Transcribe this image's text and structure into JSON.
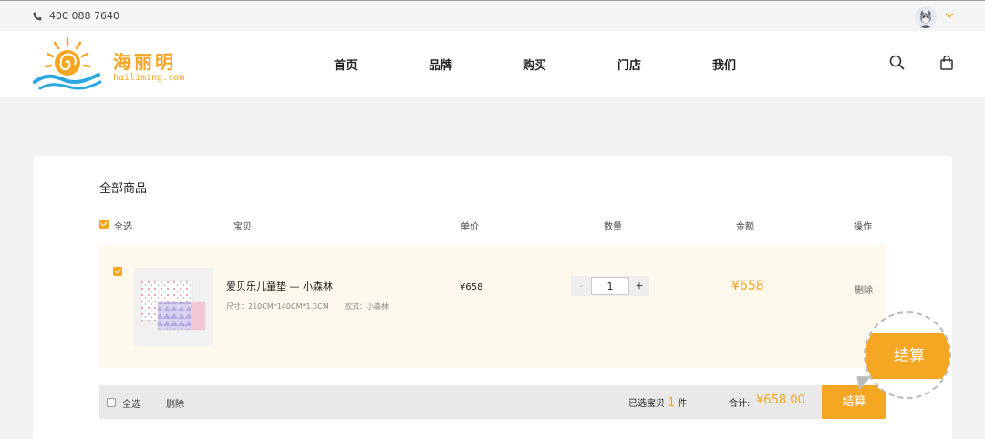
{
  "topbar": {
    "phone": "400 088 7640"
  },
  "brand": {
    "name_cn": "海丽明",
    "domain": "hailiming.com"
  },
  "nav": [
    "首页",
    "品牌",
    "购买",
    "门店",
    "我们"
  ],
  "cart": {
    "section_title": "全部商品",
    "headers": {
      "select_all": "全选",
      "item": "宝贝",
      "unit_price": "单价",
      "quantity": "数量",
      "amount": "金额",
      "action": "操作"
    },
    "item": {
      "name": "爱贝乐儿童垫 — 小森林",
      "spec": "尺寸：210CM*140CM*1.3CM",
      "style": "款式：小森林",
      "price": "¥658",
      "qty_minus": "-",
      "qty": "1",
      "qty_plus": "+",
      "amount": "¥658",
      "delete": "删除",
      "checked": true
    },
    "footer": {
      "select_all": "全选",
      "delete": "删除",
      "selected_prefix": "已选宝贝",
      "selected_count": "1",
      "selected_suffix": "件",
      "total_label": "合计:",
      "total_value": "¥658.00",
      "checkout": "结算"
    },
    "zoom_callout": "结算"
  },
  "colors": {
    "accent": "#f5a623",
    "row_bg": "#fff8ec"
  },
  "icons": {
    "phone": "phone-icon",
    "search": "search-icon",
    "bag": "shopping-bag-icon",
    "caret": "chevron-down-icon"
  }
}
